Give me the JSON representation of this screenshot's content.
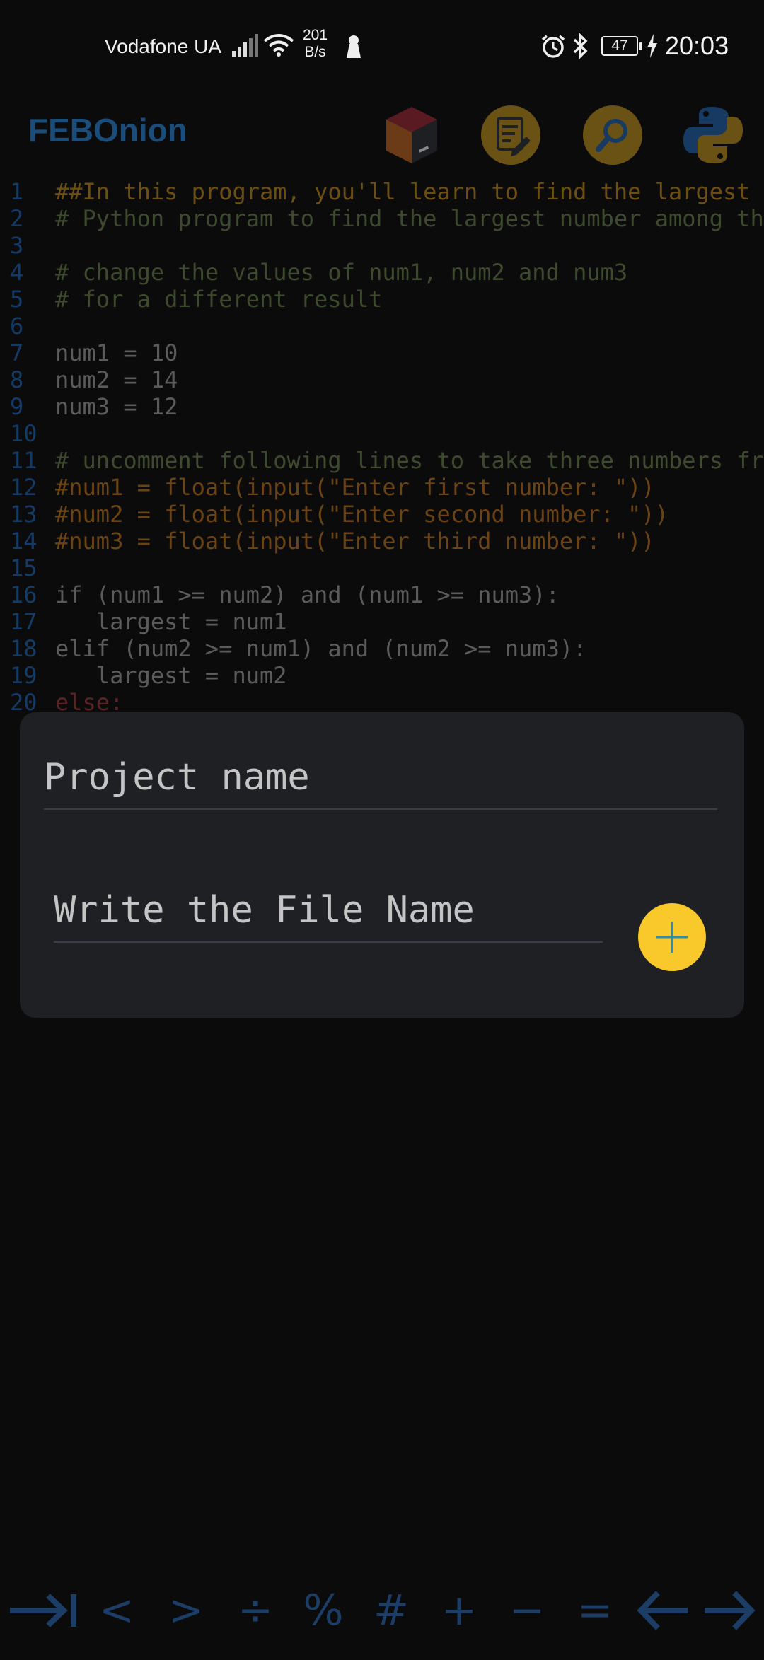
{
  "status_bar": {
    "carrier": "Vodafone UA",
    "speed_value": "201",
    "speed_unit": "B/s",
    "battery": "47",
    "time": "20:03"
  },
  "app_bar": {
    "title": "FEBOnion",
    "actions": [
      "project-cube-icon",
      "edit-note-icon",
      "search-icon",
      "python-icon"
    ]
  },
  "editor": {
    "lines": [
      {
        "n": "1",
        "text": "##In this program, you'll learn to find the largest a"
      },
      {
        "n": "2",
        "text": "# Python program to find the largest number among the"
      },
      {
        "n": "3",
        "text": ""
      },
      {
        "n": "4",
        "text": "# change the values of num1, num2 and num3"
      },
      {
        "n": "5",
        "text": "# for a different result"
      },
      {
        "n": "6",
        "text": ""
      },
      {
        "n": "7",
        "text": "num1 = 10"
      },
      {
        "n": "8",
        "text": "num2 = 14"
      },
      {
        "n": "9",
        "text": "num3 = 12"
      },
      {
        "n": "10",
        "text": ""
      },
      {
        "n": "11",
        "text": "# uncomment following lines to take three numbers fro"
      },
      {
        "n": "12",
        "text": "#num1 = float(input(\"Enter first number: \"))"
      },
      {
        "n": "13",
        "text": "#num2 = float(input(\"Enter second number: \"))"
      },
      {
        "n": "14",
        "text": "#num3 = float(input(\"Enter third number: \"))"
      },
      {
        "n": "15",
        "text": ""
      },
      {
        "n": "16",
        "text": "if (num1 >= num2) and (num1 >= num3):"
      },
      {
        "n": "17",
        "text": "   largest = num1"
      },
      {
        "n": "18",
        "text": "elif (num2 >= num1) and (num2 >= num3):"
      },
      {
        "n": "19",
        "text": "   largest = num2"
      },
      {
        "n": "20",
        "text": "else:"
      }
    ]
  },
  "dialog": {
    "project_placeholder": "Project name",
    "file_placeholder": "Write the File Name",
    "add_button_icon": "plus-icon",
    "add_button_color": "#f9c82a"
  },
  "symbol_bar": {
    "keys": [
      "tab-icon",
      "<",
      ">",
      "÷",
      "%",
      "#",
      "+",
      "−",
      "=",
      "left-arrow-icon",
      "right-arrow-icon"
    ]
  }
}
